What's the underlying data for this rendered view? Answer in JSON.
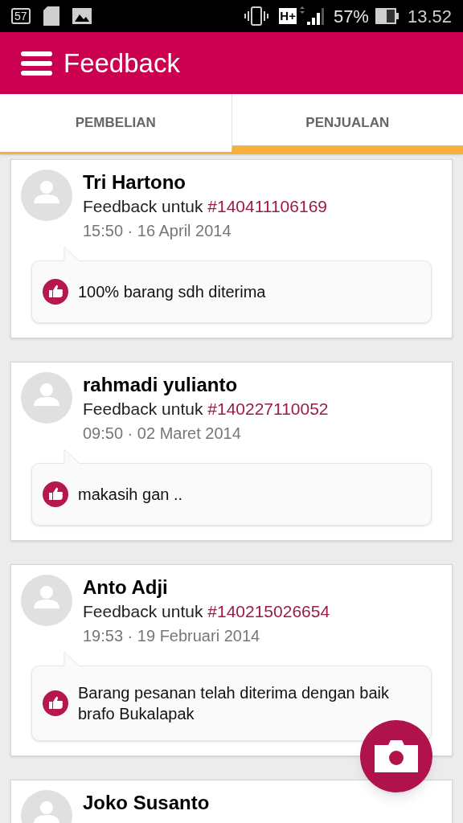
{
  "status_bar": {
    "notification_badge": "57",
    "network": "H+",
    "battery": "57%",
    "time": "13.52"
  },
  "app_bar": {
    "title": "Feedback"
  },
  "tabs": [
    {
      "label": "PEMBELIAN",
      "selected": false
    },
    {
      "label": "PENJUALAN",
      "selected": true
    }
  ],
  "feedbacks": [
    {
      "name": "Tri Hartono",
      "label": "Feedback untuk",
      "order": "#140411106169",
      "date": "15:50 · 16 April 2014",
      "kind": "positive",
      "message": "100% barang sdh diterima"
    },
    {
      "name": "rahmadi yulianto",
      "label": "Feedback untuk",
      "order": "#140227110052",
      "date": "09:50 · 02 Maret 2014",
      "kind": "positive",
      "message": "makasih gan .."
    },
    {
      "name": "Anto Adji",
      "label": "Feedback untuk",
      "order": "#140215026654",
      "date": "19:53 · 19 Februari 2014",
      "kind": "positive",
      "message": "Barang pesanan telah diterima dengan baik brafo Bukalapak"
    },
    {
      "name": "Joko Susanto"
    }
  ]
}
